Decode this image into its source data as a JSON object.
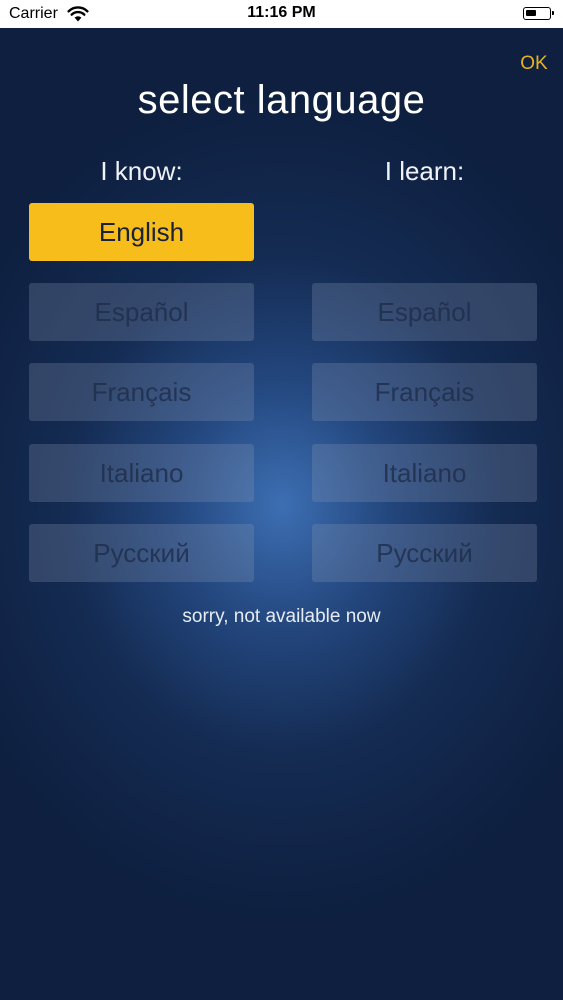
{
  "status_bar": {
    "carrier": "Carrier",
    "time": "11:16 PM"
  },
  "header": {
    "title": "select language",
    "ok_label": "OK"
  },
  "know_column": {
    "heading": "I know:",
    "items": [
      {
        "label": "English",
        "selected": true
      },
      {
        "label": "Español",
        "selected": false
      },
      {
        "label": "Français",
        "selected": false
      },
      {
        "label": "Italiano",
        "selected": false
      },
      {
        "label": "Русский",
        "selected": false
      }
    ]
  },
  "learn_column": {
    "heading": "I learn:",
    "items": [
      {
        "label": "Español",
        "selected": false
      },
      {
        "label": "Français",
        "selected": false
      },
      {
        "label": "Italiano",
        "selected": false
      },
      {
        "label": "Русский",
        "selected": false
      }
    ]
  },
  "notice": "sorry, not available now",
  "colors": {
    "accent": "#f6bd1b",
    "ok_text": "#e8b323",
    "background_center": "#3d6fb3",
    "background_edge": "#0e1f3f"
  }
}
